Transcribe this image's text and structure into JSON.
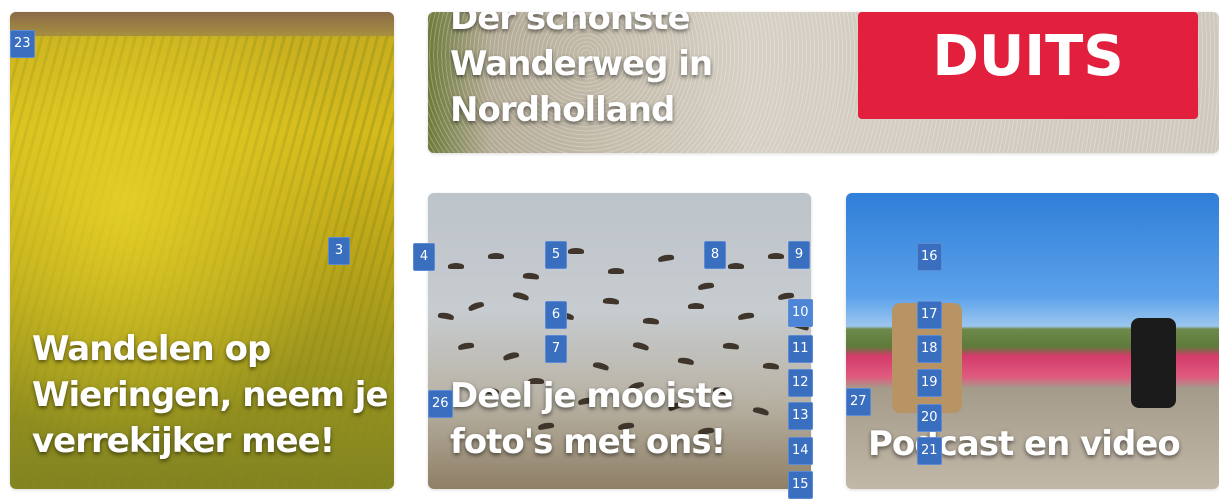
{
  "cards": [
    {
      "name": "card-wandelen",
      "title_lines": [
        "Wandelen op",
        "Wieringen, neem je",
        "verrekijker mee!"
      ]
    },
    {
      "name": "card-wanderweg",
      "title_lines": [
        "Der schönste",
        "Wanderweg in",
        "Nordholland"
      ],
      "banner": "DUITS",
      "banner_color": "#e21f3d"
    },
    {
      "name": "card-foto",
      "title_lines": [
        "Deel je mooiste",
        "foto's met ons!"
      ]
    },
    {
      "name": "card-podcast",
      "title_lines": [
        "Podcast en video"
      ]
    }
  ],
  "badges": [
    "23",
    "3",
    "4",
    "5",
    "8",
    "9",
    "6",
    "10",
    "7",
    "11",
    "12",
    "13",
    "14",
    "15",
    "16",
    "17",
    "18",
    "19",
    "20",
    "21",
    "26",
    "27"
  ],
  "colors": {
    "badge": "#3a6fbf",
    "banner": "#e21f3d"
  }
}
